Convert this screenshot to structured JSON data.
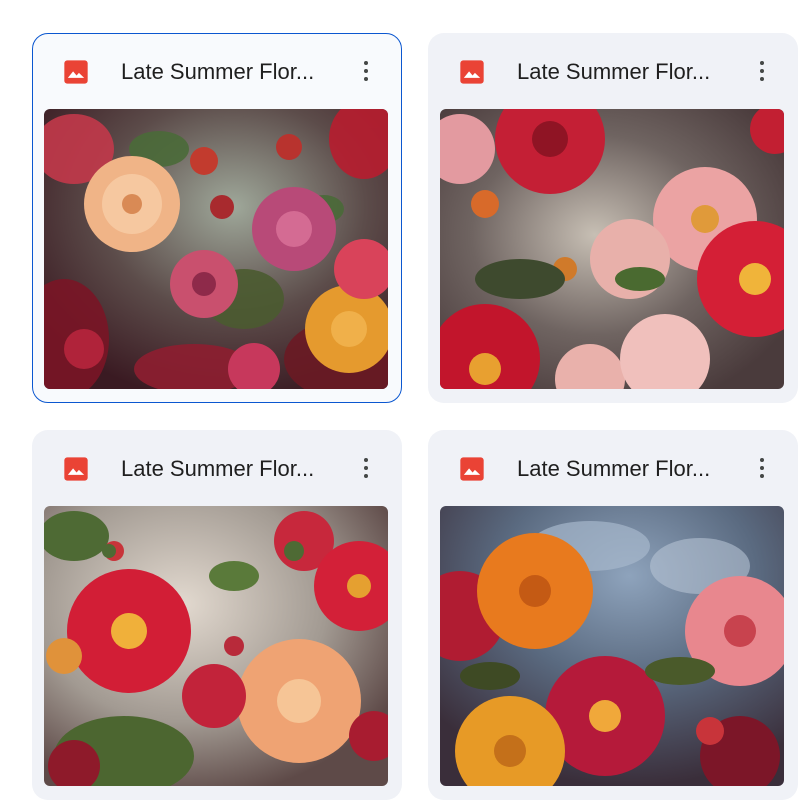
{
  "files": [
    {
      "title": "Late Summer Flor...",
      "icon": "image-file-icon",
      "selected": true
    },
    {
      "title": "Late Summer Flor...",
      "icon": "image-file-icon",
      "selected": false
    },
    {
      "title": "Late Summer Flor...",
      "icon": "image-file-icon",
      "selected": false
    },
    {
      "title": "Late Summer Flor...",
      "icon": "image-file-icon",
      "selected": false
    }
  ],
  "colors": {
    "accent": "#0b57d0",
    "image_icon": "#ea4335",
    "card_background": "#f0f2f7",
    "text": "#1f1f1f"
  }
}
